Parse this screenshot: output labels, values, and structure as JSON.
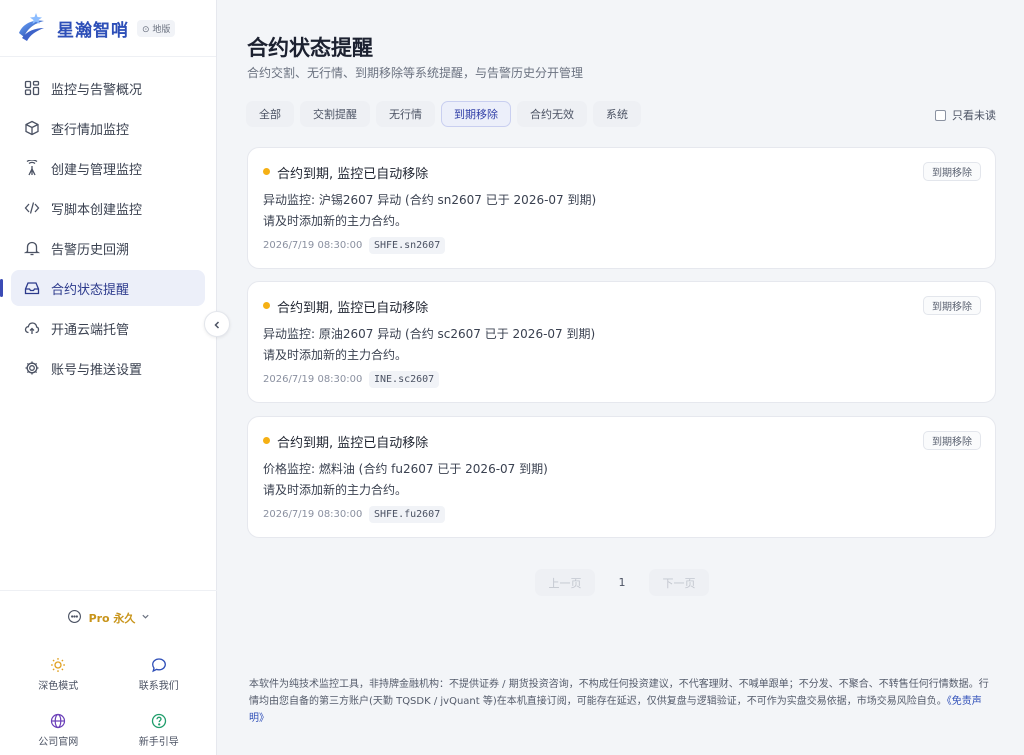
{
  "brand": {
    "name": "星瀚智哨",
    "edition": "⊙ 地版"
  },
  "nav": [
    {
      "key": "overview",
      "label": "监控与告警概况",
      "icon": "dashboard-icon"
    },
    {
      "key": "query",
      "label": "查行情加监控",
      "icon": "cube-icon"
    },
    {
      "key": "manage",
      "label": "创建与管理监控",
      "icon": "signal-icon"
    },
    {
      "key": "script",
      "label": "写脚本创建监控",
      "icon": "code-icon"
    },
    {
      "key": "history",
      "label": "告警历史回溯",
      "icon": "bell-icon"
    },
    {
      "key": "contract",
      "label": "合约状态提醒",
      "icon": "inbox-icon",
      "active": true
    },
    {
      "key": "cloud",
      "label": "开通云端托管",
      "icon": "cloud-upload-icon"
    },
    {
      "key": "settings",
      "label": "账号与推送设置",
      "icon": "gear-icon"
    }
  ],
  "plan": {
    "label": "Pro 永久"
  },
  "bottom": {
    "dark_mode": "深色模式",
    "contact": "联系我们",
    "website": "公司官网",
    "guide": "新手引导"
  },
  "page": {
    "title": "合约状态提醒",
    "subtitle": "合约交割、无行情、到期移除等系统提醒，与告警历史分开管理"
  },
  "tabs": [
    {
      "label": "全部"
    },
    {
      "label": "交割提醒"
    },
    {
      "label": "无行情"
    },
    {
      "label": "到期移除",
      "active": true
    },
    {
      "label": "合约无效"
    },
    {
      "label": "系统"
    }
  ],
  "unread_only": "只看未读",
  "cards": [
    {
      "title": "合约到期, 监控已自动移除",
      "tag": "到期移除",
      "line1": "异动监控: 沪锡2607 异动 (合约 sn2607 已于 2026-07 到期)",
      "line2": "请及时添加新的主力合约。",
      "time": "2026/7/19 08:30:00",
      "sep": "·",
      "code": "SHFE.sn2607"
    },
    {
      "title": "合约到期, 监控已自动移除",
      "tag": "到期移除",
      "line1": "异动监控: 原油2607 异动 (合约 sc2607 已于 2026-07 到期)",
      "line2": "请及时添加新的主力合约。",
      "time": "2026/7/19 08:30:00",
      "sep": "·",
      "code": "INE.sc2607"
    },
    {
      "title": "合约到期, 监控已自动移除",
      "tag": "到期移除",
      "line1": "价格监控: 燃料油 (合约 fu2607 已于 2026-07 到期)",
      "line2": "请及时添加新的主力合约。",
      "time": "2026/7/19 08:30:00",
      "sep": "·",
      "code": "SHFE.fu2607"
    }
  ],
  "pager": {
    "prev": "上一页",
    "page": "1",
    "next": "下一页"
  },
  "disclaimer": {
    "text": "本软件为纯技术监控工具，非持牌金融机构：不提供证券 / 期货投资咨询，不构成任何投资建议，不代客理财、不喊单跟单；不分发、不聚合、不转售任何行情数据。行情均由您自备的第三方账户(天勤 TQSDK / jvQuant 等)在本机直接订阅，可能存在延迟，仅供复盘与逻辑验证，不可作为实盘交易依据，市场交易风险自负。",
    "link": "《免责声明》"
  },
  "colors": {
    "accent": "#3b4bb5",
    "brand": "#2d4fb8",
    "dot": "#f5b014",
    "pro": "#c8941a"
  }
}
